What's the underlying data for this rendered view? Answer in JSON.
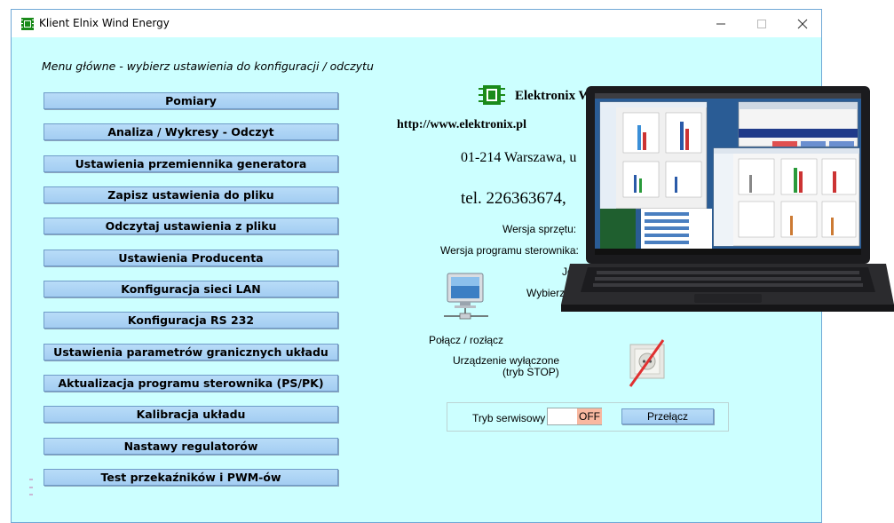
{
  "window": {
    "title": "Klient Elnix Wind Energy"
  },
  "menu": {
    "header": "Menu główne - wybierz ustawienia do konfiguracji / odczytu",
    "buttons": [
      "Pomiary",
      "Analiza / Wykresy - Odczyt",
      "Ustawienia przemiennika generatora",
      "Zapisz ustawienia do pliku",
      "Odczytaj ustawienia z pliku",
      "Ustawienia Producenta",
      "Konfiguracja sieci LAN",
      "Konfiguracja RS 232",
      "Ustawienia parametrów granicznych układu",
      "Aktualizacja programu sterownika (PS/PK)",
      "Kalibracja układu",
      "Nastawy regulatorów",
      "Test przekaźników i PWM-ów"
    ]
  },
  "company": {
    "name": "Elektronix Warszawa",
    "url": "http://www.elektronix.pl",
    "address": "01-214 Warszawa, u",
    "phone": "tel. 226363674,"
  },
  "info": {
    "hardware_version": "Wersja sprzętu:",
    "firmware_version": "Wersja programu sterownika:",
    "language": "Języ",
    "choose": "Wybierz",
    "connect": "Połącz / rozłącz",
    "device_off": "Urządzenie wyłączone",
    "device_off_mode": "(tryb STOP)"
  },
  "service": {
    "label": "Tryb serwisowy",
    "value": "OFF",
    "toggle": "Przełącz"
  },
  "icons": {
    "app": "app-chip-icon",
    "network": "network-computer-icon",
    "stop": "power-socket-crossed-icon",
    "laptop": "laptop-screenshot-image"
  },
  "colors": {
    "background": "#ccffff",
    "button": "#a3cdf2",
    "off_value": "#f8b8a0",
    "stop_cross": "#e03030"
  }
}
